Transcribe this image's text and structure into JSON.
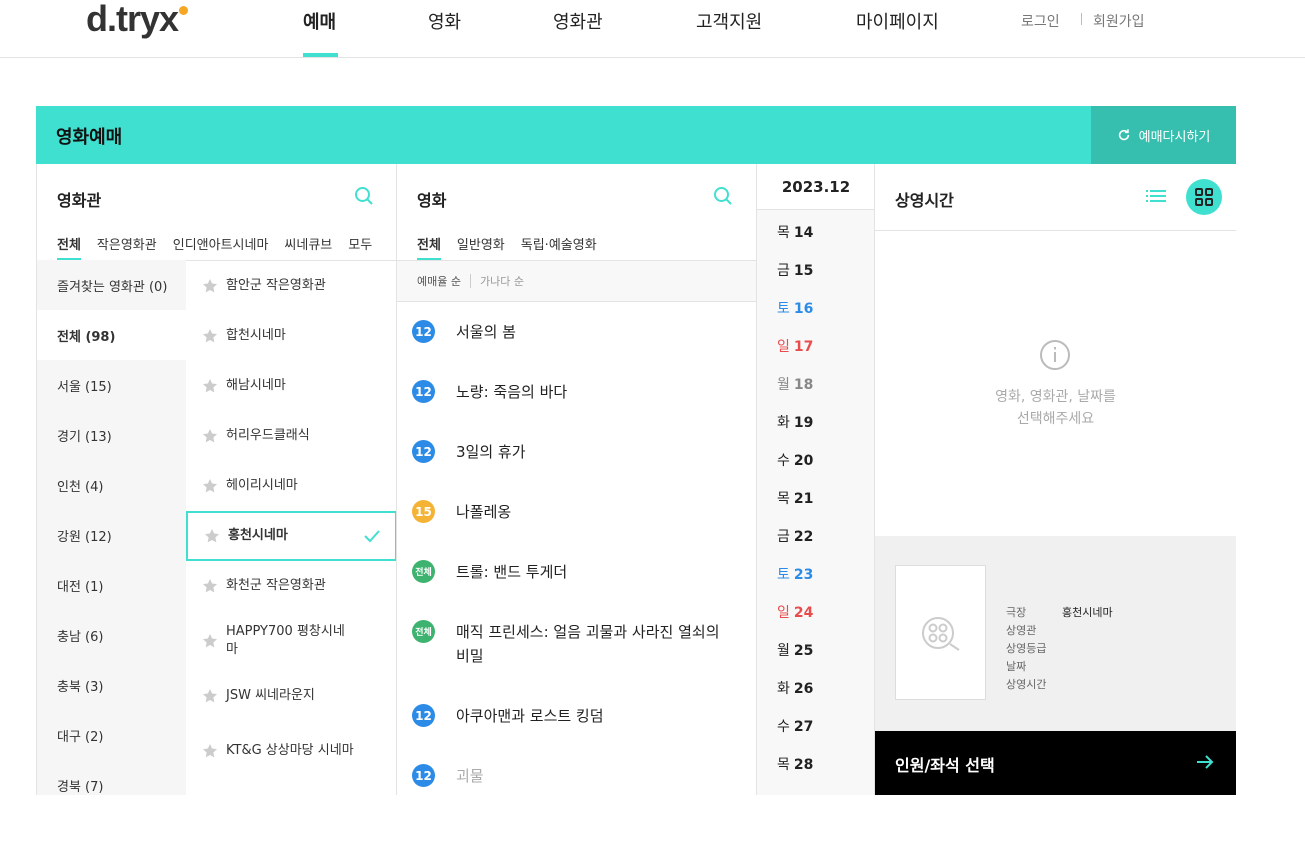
{
  "header": {
    "logo": "d.tryx",
    "nav": [
      {
        "label": "예매",
        "active": true
      },
      {
        "label": "영화"
      },
      {
        "label": "영화관"
      },
      {
        "label": "고객지원"
      },
      {
        "label": "마이페이지"
      }
    ],
    "login": "로그인",
    "signup": "회원가입"
  },
  "booking": {
    "title": "영화예매",
    "reset_label": "예매다시하기"
  },
  "cinema_panel": {
    "title": "영화관",
    "tabs": [
      "전체",
      "작은영화관",
      "인디앤아트시네마",
      "씨네큐브",
      "모두"
    ],
    "regions": [
      "즐겨찾는 영화관 (0)",
      "전체 (98)",
      "서울 (15)",
      "경기 (13)",
      "인천 (4)",
      "강원 (12)",
      "대전 (1)",
      "충남 (6)",
      "충북 (3)",
      "대구 (2)",
      "경북 (7)"
    ],
    "active_region": "전체 (98)",
    "cinemas": [
      "함안군 작은영화관",
      "합천시네마",
      "해남시네마",
      "허리우드클래식",
      "헤이리시네마",
      "홍천시네마",
      "화천군 작은영화관",
      "HAPPY700 평창시네마",
      "JSW 씨네라운지",
      "KT&G 상상마당 시네마"
    ],
    "selected_cinema": "홍천시네마"
  },
  "movie_panel": {
    "title": "영화",
    "tabs": [
      "전체",
      "일반영화",
      "독립·예술영화"
    ],
    "sort": [
      "예매율 순",
      "가나다 순"
    ],
    "movies": [
      {
        "rating": "12",
        "title": "서울의 봄"
      },
      {
        "rating": "12",
        "title": "노량: 죽음의 바다"
      },
      {
        "rating": "12",
        "title": "3일의 휴가"
      },
      {
        "rating": "15",
        "title": "나폴레옹"
      },
      {
        "rating": "전체",
        "title": "트롤: 밴드 투게더"
      },
      {
        "rating": "전체",
        "title": "매직 프린세스: 얼음 괴물과 사라진 열쇠의 비밀"
      },
      {
        "rating": "12",
        "title": "아쿠아맨과 로스트 킹덤"
      },
      {
        "rating": "12",
        "title": "괴물"
      }
    ],
    "colors": {
      "12": "#2b8be6",
      "15": "#f5b335",
      "전체": "#3db36f"
    }
  },
  "date_panel": {
    "month": "2023.12",
    "dates": [
      {
        "day": "목",
        "num": "14"
      },
      {
        "day": "금",
        "num": "15"
      },
      {
        "day": "토",
        "num": "16"
      },
      {
        "day": "일",
        "num": "17"
      },
      {
        "day": "월",
        "num": "18"
      },
      {
        "day": "화",
        "num": "19"
      },
      {
        "day": "수",
        "num": "20"
      },
      {
        "day": "목",
        "num": "21"
      },
      {
        "day": "금",
        "num": "22"
      },
      {
        "day": "토",
        "num": "23"
      },
      {
        "day": "일",
        "num": "24"
      },
      {
        "day": "월",
        "num": "25"
      },
      {
        "day": "화",
        "num": "26"
      },
      {
        "day": "수",
        "num": "27"
      },
      {
        "day": "목",
        "num": "28"
      }
    ]
  },
  "showtime_panel": {
    "title": "상영시간",
    "empty_line1": "영화, 영화관, 날짜를",
    "empty_line2": "선택해주세요",
    "summary": {
      "theater_label": "극장",
      "theater_value": "홍천시네마",
      "screen_label": "상영관",
      "grade_label": "상영등급",
      "date_label": "날짜",
      "time_label": "상영시간"
    },
    "next_label": "인원/좌석 선택"
  },
  "accent_color": "#40e0d0"
}
